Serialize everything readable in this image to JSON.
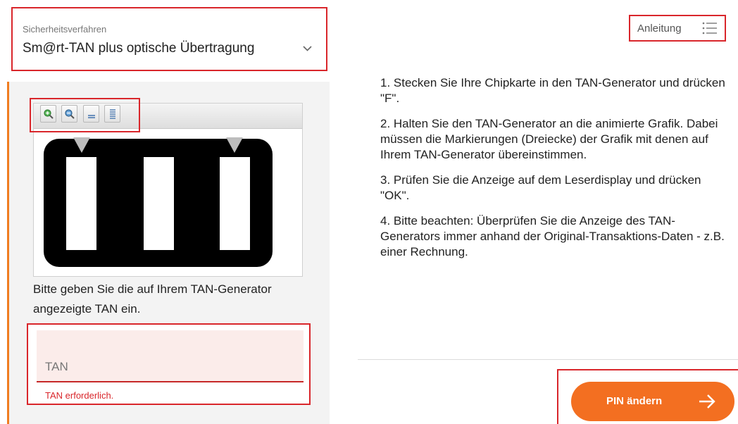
{
  "security": {
    "label": "Sicherheitsverfahren",
    "value": "Sm@rt-TAN plus optische Übertragung"
  },
  "viewer_tools": [
    "zoom-in-icon",
    "zoom-out-icon",
    "slower-icon",
    "faster-icon"
  ],
  "instruction": "Bitte geben Sie die auf Ihrem TAN-Generator angezeigte TAN ein.",
  "tan": {
    "placeholder": "TAN",
    "value": "",
    "error": "TAN erforderlich."
  },
  "guide": {
    "label": "Anleitung"
  },
  "steps": [
    "1. Stecken Sie Ihre Chipkarte in den TAN-Generator und drücken \"F\".",
    "2. Halten Sie den TAN-Generator an die animierte Grafik. Dabei müssen die Markierungen (Dreiecke) der Grafik mit denen auf Ihrem TAN-Generator übereinstimmen.",
    "3. Prüfen Sie die Anzeige auf dem Leserdisplay und drücken \"OK\".",
    "4. Bitte beachten: Überprüfen Sie die Anzeige des TAN-Generators immer anhand der Original-Transaktions-Daten - z.B. einer Rechnung."
  ],
  "button": {
    "label": "PIN ändern"
  },
  "colors": {
    "accent": "#f36f21",
    "highlight_border": "#d9262b",
    "error": "#d9262b",
    "input_bg": "#fbecea"
  }
}
